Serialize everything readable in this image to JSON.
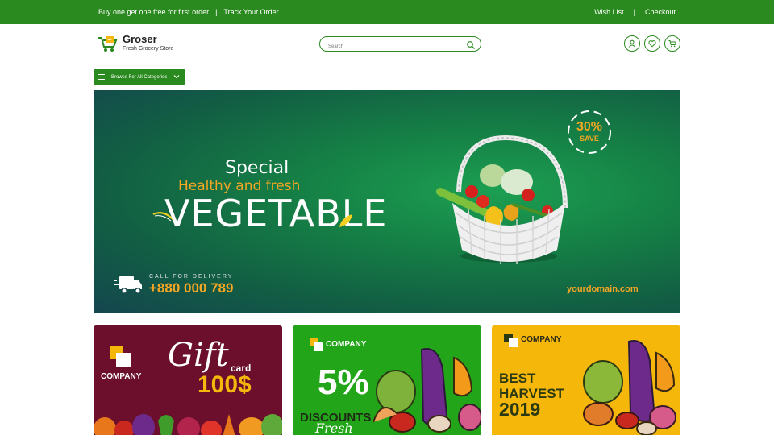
{
  "topbar": {
    "promo": "Buy one get one free for first order",
    "separator": "|",
    "track": "Track Your Order",
    "wishlist": "Wish List",
    "checkout": "Checkout"
  },
  "brand": {
    "name": "Groser",
    "tagline": "Fresh Grocery Store",
    "color": "#2a8a1f"
  },
  "search": {
    "placeholder": "Search"
  },
  "categories": {
    "label": "Browse For All Categories"
  },
  "hero": {
    "line1": "Special",
    "line2": "Healthy and fresh",
    "headline": "VEGETABLE",
    "badge_pct": "30%",
    "badge_save": "SAVE",
    "call_label": "CALL FOR DELIVERY",
    "phone": "+880 000 789",
    "domain": "yourdomain.com"
  },
  "promos": [
    {
      "company": "COMPANY",
      "title": "Gift",
      "subtitle": "card",
      "amount": "100$"
    },
    {
      "company": "COMPANY",
      "percent": "5%",
      "line1": "DISCOUNTS",
      "line2": "Fresh"
    },
    {
      "company": "COMPANY",
      "line1": "BEST",
      "line2": "HARVEST",
      "line3": "2019"
    }
  ],
  "icons": [
    "cart-logo-icon",
    "search-icon",
    "user-icon",
    "heart-icon",
    "cart-icon",
    "menu-icon",
    "chevron-down-icon",
    "truck-icon"
  ]
}
